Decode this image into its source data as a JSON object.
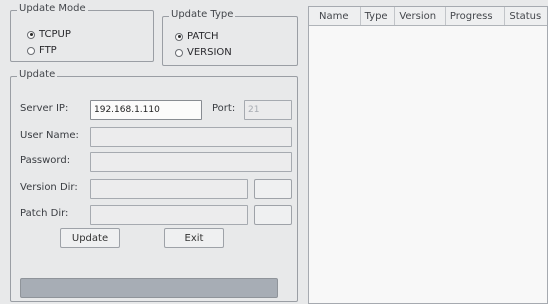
{
  "update_mode": {
    "legend": "Update Mode",
    "options": [
      {
        "label": "TCPUP",
        "checked": true
      },
      {
        "label": "FTP",
        "checked": false
      }
    ]
  },
  "update_type": {
    "legend": "Update Type",
    "options": [
      {
        "label": "PATCH",
        "checked": true
      },
      {
        "label": "VERSION",
        "checked": false
      }
    ]
  },
  "update": {
    "legend": "Update",
    "server_ip_label": "Server IP:",
    "server_ip_value": "192.168.1.110",
    "port_label": "Port:",
    "port_value": "21",
    "user_name_label": "User Name:",
    "user_name_value": "",
    "password_label": "Password:",
    "password_value": "",
    "version_dir_label": "Version Dir:",
    "version_dir_value": "",
    "patch_dir_label": "Patch Dir:",
    "patch_dir_value": "",
    "update_button": "Update",
    "exit_button": "Exit"
  },
  "file_table": {
    "columns": [
      "Name",
      "Type",
      "Version",
      "Progress",
      "Status"
    ],
    "rows": []
  }
}
